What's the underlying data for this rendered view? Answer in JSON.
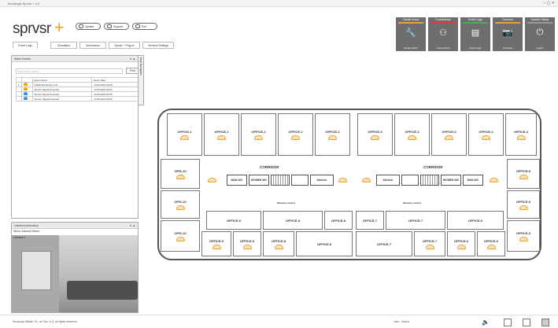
{
  "window": {
    "title": "Novalogic Sprvsr + 4.0",
    "controls": "– ▢ ✕"
  },
  "app": {
    "logo": "sprvsr",
    "logo_plus": "+"
  },
  "toolbar": {
    "buttons": [
      {
        "label": "Update",
        "icon": "update-icon"
      },
      {
        "label": "Support",
        "icon": "support-icon"
      },
      {
        "label": "Exit",
        "icon": "exit-icon"
      }
    ]
  },
  "tabs": [
    {
      "label": "Event Logs",
      "active": true
    },
    {
      "label": "Simulation"
    },
    {
      "label": "Summaries"
    },
    {
      "label": "Sprvsr + Plug-In"
    },
    {
      "label": "General Settings"
    }
  ],
  "tiles": [
    {
      "header": "Create Action",
      "caption": "Create Action",
      "stripe": "#e8a23c",
      "glyph": "🔧"
    },
    {
      "header": "Connections",
      "caption": "Connections",
      "stripe": "#d83c3c",
      "glyph": "⚇"
    },
    {
      "header": "Event Logs",
      "caption": "Event Logs",
      "stripe": "#4caf50",
      "glyph": "▤"
    },
    {
      "header": "Cameras",
      "caption": "Cameras",
      "stripe": "#e8a23c",
      "glyph": "📷"
    },
    {
      "header": "System Status",
      "caption": "Logout",
      "stripe": "#999999",
      "glyph": "⏻"
    }
  ],
  "alarm_panel": {
    "title": "Alarm Events",
    "search_placeholder": "Enter text to search...",
    "find_label": "Find",
    "columns": [
      "",
      "",
      "Event Name",
      "Event Date"
    ],
    "rows": [
      {
        "name": "ISSLE Monitoring Lost",
        "date": "13.05.2020 09:56",
        "color": "orange",
        "marker": "▸"
      },
      {
        "name": "Sensor Signal Detected",
        "date": "13.05.2020 09:56",
        "color": "orange",
        "marker": ""
      },
      {
        "name": "Sensor Signal Detected",
        "date": "13.05.2020 09:56",
        "color": "blue",
        "marker": ""
      },
      {
        "name": "Sensor Signal Detected",
        "date": "13.05.2020 09:56",
        "color": "blue",
        "marker": ""
      }
    ]
  },
  "side_tab": {
    "label": "Map Navigator"
  },
  "camera_panel": {
    "title": "Camera Information",
    "info_line": "Menu  Camera Select",
    "camera_name": "Camera 1"
  },
  "floorplan": {
    "corridor_left": "CORRIDOR",
    "corridor_right": "CORRIDOR",
    "elevator_left": "Elevator control",
    "elevator_right": "Elevator control",
    "kitchen_left": "Kitchen",
    "kitchen_right": "Kitchen",
    "man_wc": "MAN WC",
    "women_wc": "WOMEN WC",
    "rooms_top": [
      "OFFICE-1",
      "OFFICE-1",
      "OFFICE-2",
      "OFFICE-2",
      "OFFICE-2",
      "OFFICE-3",
      "OFFICE-3",
      "OFFICE-3",
      "OFFICE-4",
      "OFFICE-4"
    ],
    "rooms_left": [
      "OFİS-10",
      "OFİS-10",
      "OFİS-10"
    ],
    "rooms_right": [
      "OFFICE-5",
      "OFFICE-5",
      "OFFICE-5"
    ],
    "rooms_bottom_row1": [
      "OFFICE-9",
      "OFFICE-8",
      "OFFICE-8",
      "OFFICE-7",
      "OFFICE-7",
      "OFFICE-6"
    ],
    "rooms_bottom_row2": [
      "OFFICE-9",
      "OFFICE-9",
      "OFFICE-8",
      "OFFICE-8",
      "OFFICE-7",
      "OFFICE-7",
      "OFFICE-6",
      "OFFICE-6"
    ]
  },
  "statusbar": {
    "copyright": "Novalogic Bilişim Tic. ve San. A.Ş. all rights reserved",
    "user": "User : Admin"
  }
}
